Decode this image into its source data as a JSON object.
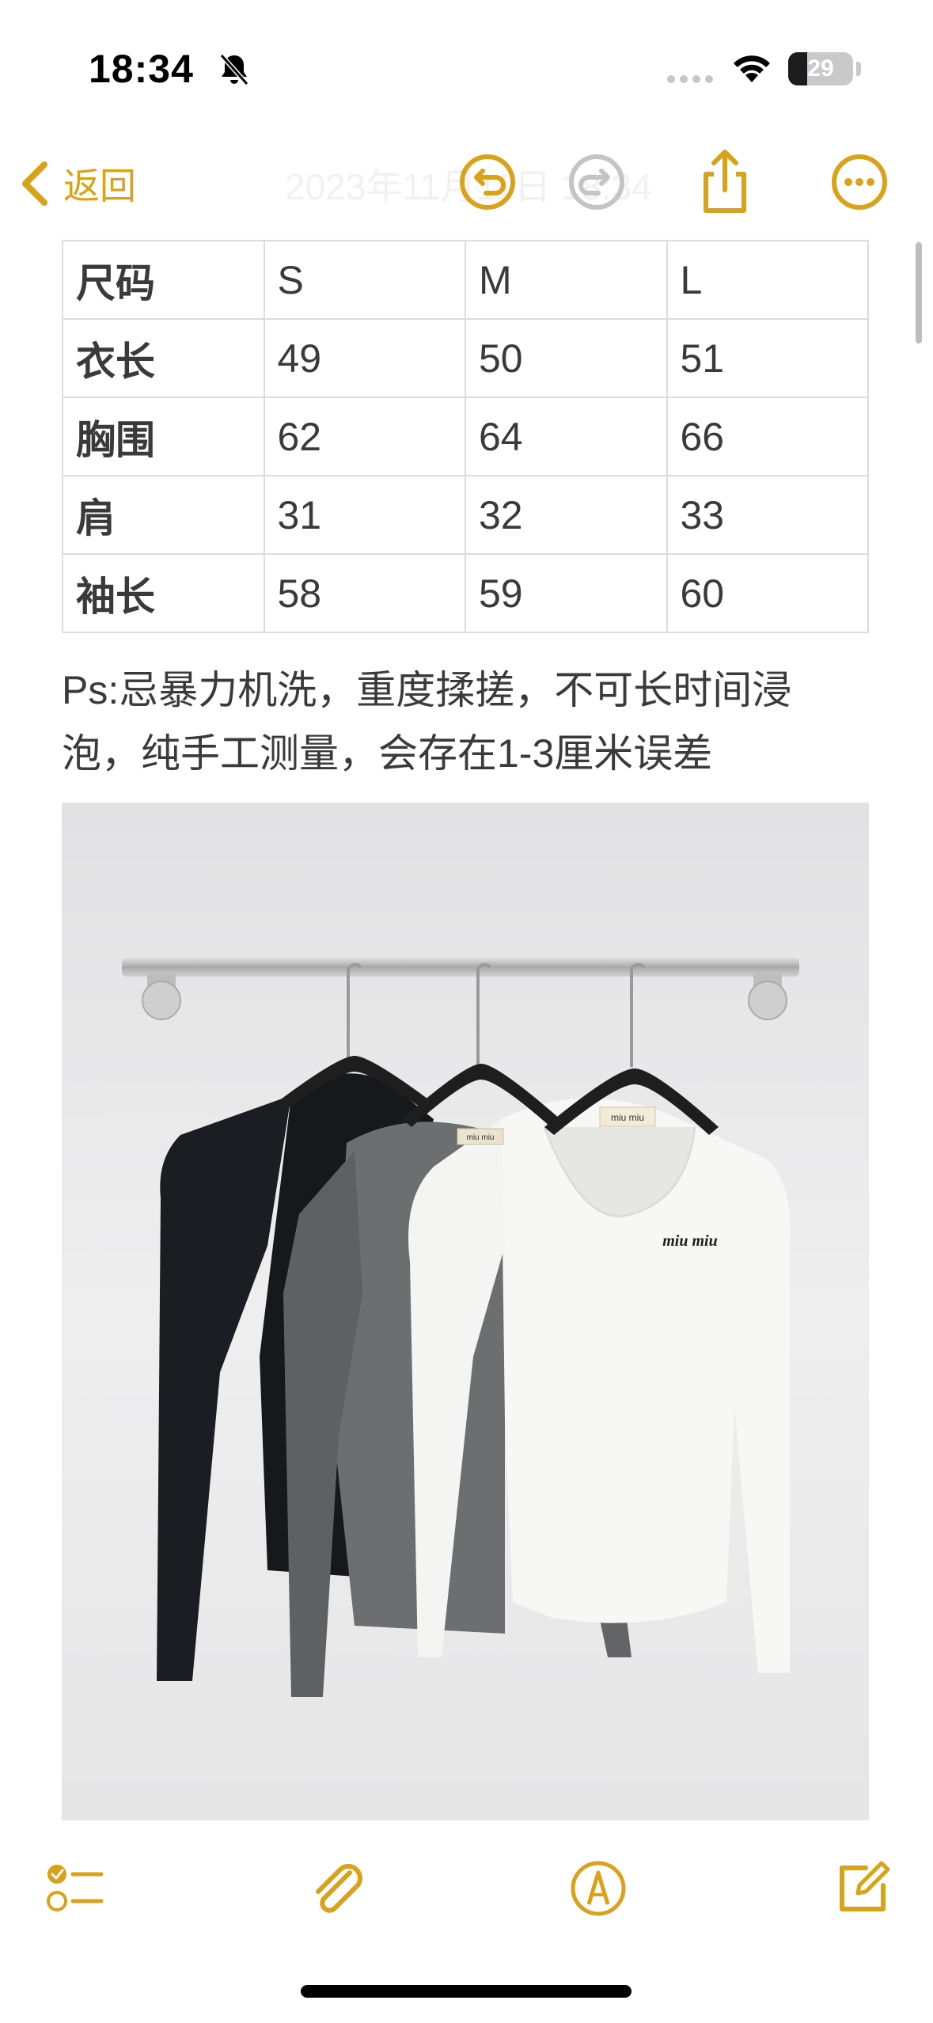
{
  "status_bar": {
    "time": "18:34",
    "battery_percent": "29",
    "battery_level": 0.29,
    "icons": [
      "bell-slash-icon",
      "cellular-signal-icon",
      "wifi-icon",
      "battery-icon"
    ]
  },
  "nav": {
    "back_label": "返回",
    "title": "2023年11月11日 18:34",
    "icons": [
      "undo-icon",
      "redo-icon",
      "share-icon",
      "more-icon"
    ]
  },
  "size_table": {
    "header": [
      "尺码",
      "S",
      "M",
      "L"
    ],
    "rows": [
      [
        "衣长",
        "49",
        "50",
        "51"
      ],
      [
        "胸围",
        "62",
        "64",
        "66"
      ],
      [
        "肩",
        "31",
        "32",
        "33"
      ],
      [
        "袖长",
        "58",
        "59",
        "60"
      ]
    ]
  },
  "note": {
    "line1": "Ps:忌暴力机洗，重度揉搓，不可长时间浸",
    "line2": "泡，纯手工测量，会存在1-3厘米误差"
  },
  "photo": {
    "logo_text": "miu miu"
  },
  "toolbar": {
    "icons": [
      "checklist-icon",
      "paperclip-icon",
      "markup-pen-icon",
      "compose-icon"
    ]
  },
  "colors": {
    "accent": "#d8a21a",
    "text": "#3a3a3c",
    "table_border": "#dcdcdc"
  }
}
